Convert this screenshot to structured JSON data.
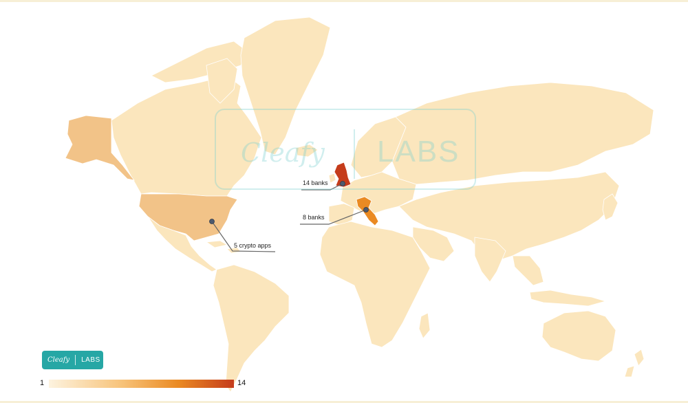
{
  "map": {
    "watermark": {
      "brand": "Cleafy",
      "product": "LABS"
    },
    "logo": {
      "brand": "Cleafy",
      "product": "LABS"
    },
    "legend": {
      "min": "1",
      "max": "14",
      "colors": [
        "#fdf3df",
        "#f7c278",
        "#ea8a23",
        "#c53c1b"
      ]
    },
    "regions": [
      {
        "name": "United Kingdom",
        "value": 14,
        "color": "#c53c1b"
      },
      {
        "name": "Italy",
        "value": 8,
        "color": "#ea8a23"
      },
      {
        "name": "United States",
        "value": 5,
        "color": "#f2c388"
      },
      {
        "name": "Alaska",
        "value": 5,
        "color": "#f2c388"
      }
    ],
    "callouts": {
      "uk": {
        "text": "14 banks"
      },
      "italy": {
        "text": "8 banks"
      },
      "usa": {
        "text": "5 crypto apps"
      }
    },
    "base_color": "#fbe6bd"
  }
}
